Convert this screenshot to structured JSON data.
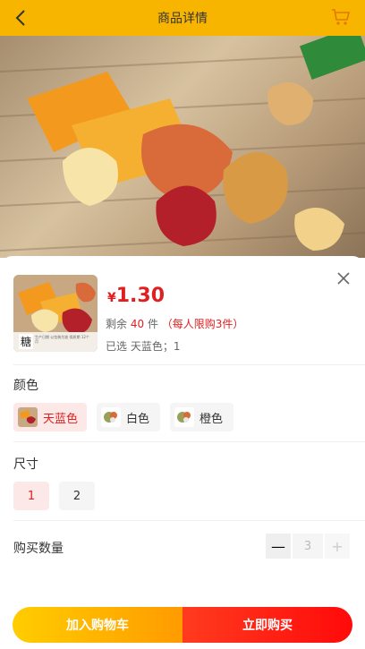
{
  "header": {
    "title": "商品详情",
    "icons": {
      "back": "chevron-left-icon",
      "cart": "cart-icon"
    }
  },
  "product": {
    "thumb_tag": "糖",
    "thumb_fine_text": "生产日期 以包装为准 保质期 12个月",
    "price_symbol": "¥",
    "price": "1.30",
    "stock_prefix": "剩余",
    "stock_count": "40",
    "stock_unit": "件",
    "limit_note": "（每人限购3件）",
    "selected_text": "已选 天蓝色；1"
  },
  "color": {
    "label": "颜色",
    "options": [
      {
        "label": "天蓝色",
        "selected": true
      },
      {
        "label": "白色",
        "selected": false
      },
      {
        "label": "橙色",
        "selected": false
      }
    ]
  },
  "size": {
    "label": "尺寸",
    "options": [
      {
        "label": "1",
        "selected": true
      },
      {
        "label": "2",
        "selected": false
      }
    ]
  },
  "quantity": {
    "label": "购买数量",
    "value": "3",
    "minus": "—",
    "plus": "+"
  },
  "actions": {
    "add_to_cart": "加入购物车",
    "buy_now": "立即购买"
  },
  "colors": {
    "accent": "#e02020",
    "header": "#f7b500"
  }
}
